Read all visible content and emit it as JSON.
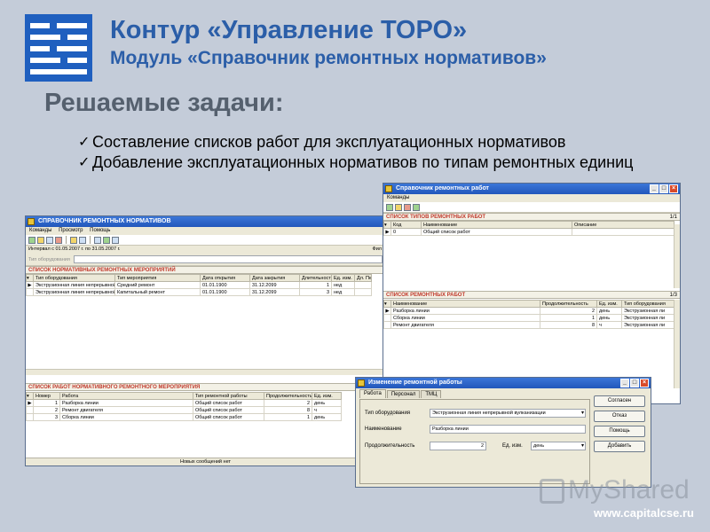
{
  "header": {
    "title": "Контур «Управление ТОРО»",
    "subtitle": "Модуль «Справочник ремонтных нормативов»"
  },
  "tasks": {
    "heading": "Решаемые задачи:",
    "items": [
      "Составление списков работ для эксплуатационных нормативов",
      "Добавление эксплуатационных нормативов по типам ремонтных единиц"
    ]
  },
  "footer": {
    "site": "www.capitalcse.ru",
    "watermark": "MyShared"
  },
  "main_window": {
    "title": "СПРАВОЧНИК РЕМОНТНЫХ НОРМАТИВОВ",
    "menu": [
      "Команды",
      "Просмотр",
      "Помощь"
    ],
    "interval": "Интервал с 01.05.2007 г. по 31.05.2007 г.",
    "filter_label": "Фил",
    "filter_placeholder": "Тип оборудования",
    "norms_section": "СПИСОК НОРМАТИВНЫХ РЕМОНТНЫХ МЕРОПРИЯТИЙ",
    "norms_columns": [
      "Тип оборудования",
      "Тип мероприятия",
      "Дата открытия",
      "Дата закрытия",
      "Длительность",
      "Ед. изм.",
      "Дл. Пер"
    ],
    "norms_rows": [
      [
        "Экструзионная линия непрерывной",
        "Средний ремонт",
        "01.01.1900",
        "31.12.2099",
        "1",
        "нед",
        ""
      ],
      [
        "Экструзионная линия непрерывной",
        "Капитальный ремонт",
        "01.01.1900",
        "31.12.2099",
        "3",
        "нед",
        ""
      ]
    ],
    "works_section": "СПИСОК РАБОТ НОРМАТИВНОГО РЕМОНТНОГО МЕРОПРИЯТИЯ",
    "works_columns": [
      "Номер",
      "Работа",
      "Тип ремонтной работы",
      "Продолжительность",
      "Ед. изм."
    ],
    "works_rows": [
      [
        "1",
        "Разборка линии",
        "Общий список работ",
        "2",
        "день"
      ],
      [
        "2",
        "Ремонт двигателя",
        "Общий список работ",
        "8",
        "ч"
      ],
      [
        "3",
        "Сборка линии",
        "Общий список работ",
        "1",
        "день"
      ]
    ],
    "status": "Новых сообщений нет"
  },
  "works_window": {
    "title": "Справочник ремонтных работ",
    "menu": [
      "Команды"
    ],
    "types_section": "СПИСОК ТИПОВ РЕМОНТНЫХ РАБОТ",
    "types_page": "1/1",
    "types_columns": [
      "Код",
      "Наименование",
      "Описание"
    ],
    "types_rows": [
      [
        "0",
        "Общий список работ",
        ""
      ]
    ],
    "works_section": "СПИСОК РЕМОНТНЫХ РАБОТ",
    "works_page": "1/3",
    "works_columns": [
      "Наименование",
      "Продолжительность",
      "Ед. изм.",
      "Тип оборудования"
    ],
    "works_rows": [
      [
        "Разборка линии",
        "2",
        "день",
        "Экструзионная ли"
      ],
      [
        "Сборка линии",
        "1",
        "день",
        "Экструзионная ли"
      ],
      [
        "Ремонт двигателя",
        "8",
        "ч",
        "Экструзионная ли"
      ]
    ]
  },
  "edit_window": {
    "title": "Изменение ремонтной работы",
    "tabs": [
      "Работа",
      "Персонал",
      "ТМЦ"
    ],
    "equipment_label": "Тип оборудования",
    "equipment_value": "Экструзионная линия непрерывной вулканизации",
    "name_label": "Наименование",
    "name_value": "Разборка линии",
    "duration_label": "Продолжительность",
    "duration_value": "2",
    "unit_label": "Ед. изм.",
    "unit_value": "день",
    "buttons": [
      "Согласен",
      "Отказ",
      "Помощь",
      "Добавить"
    ]
  }
}
